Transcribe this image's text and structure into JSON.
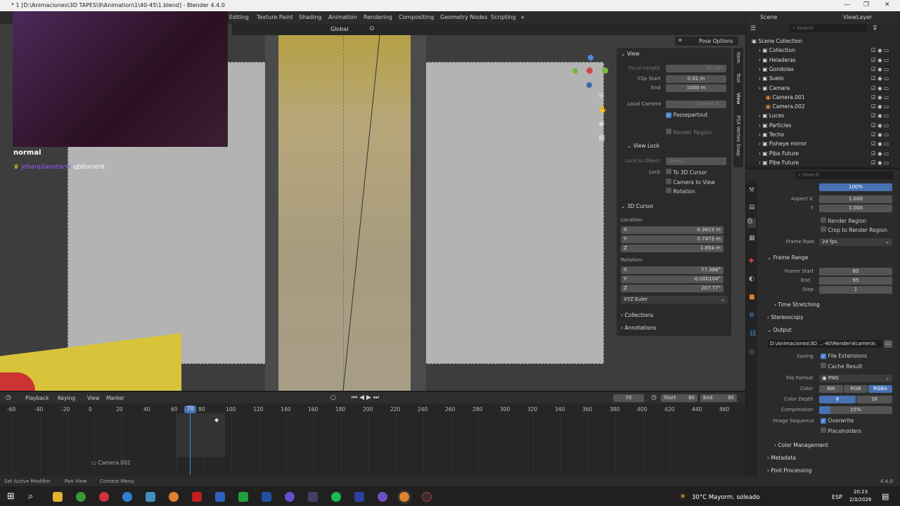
{
  "window": {
    "title": "* 1 [D:\\Animaciones\\3D TAPES\\9\\Animation\\1\\40-45\\1.blend] - Blender 4.4.0",
    "min": "—",
    "max": "❐",
    "close": "✕"
  },
  "workspaces": [
    "Editing",
    "Texture Paint",
    "Shading",
    "Animation",
    "Rendering",
    "Compositing",
    "Geometry Nodes",
    "Scripting",
    "+"
  ],
  "scene": {
    "label": "Scene",
    "viewlayer": "ViewLayer"
  },
  "viewport": {
    "orientation": "Global",
    "pose_options": "Pose Options"
  },
  "overlay": {
    "line1": "normal",
    "user": "johanplanetartx",
    "line2": "qbitorrent"
  },
  "npanel": {
    "tabs": [
      "Item",
      "Tool",
      "View",
      "PSX Vertex Snap"
    ],
    "view_header": "View",
    "focal_label": "Focal Length",
    "focal_value": "50 mm",
    "clip_start_label": "Clip Start",
    "clip_start": "0.01 m",
    "end_label": "End",
    "clip_end": "1000 m",
    "local_camera_label": "Local Camera",
    "local_camera_value": "Camera.0...",
    "passepartout": "Passepartout",
    "render_region": "Render Region",
    "view_lock_header": "View Lock",
    "lock_to_object": "Lock to Object",
    "object_ph": "Object",
    "lock_label": "Lock",
    "to_3d_cursor": "To 3D Cursor",
    "camera_to_view": "Camera to View",
    "rotation_lock": "Rotation",
    "cursor_header": "3D Cursor",
    "location_label": "Location:",
    "x": "X",
    "y": "Y",
    "z": "Z",
    "loc_x": "-0.3623 m",
    "loc_y": "0.7473 m",
    "loc_z": "1.854 m",
    "rotation_label": "Rotation:",
    "rot_x": "77.386°",
    "rot_y": "-0.000104°",
    "rot_z": "207.77°",
    "rot_mode": "XYZ Euler",
    "collections": "Collections",
    "annotations": "Annotations"
  },
  "outliner": {
    "search_ph": "Search",
    "items": [
      {
        "name": "Scene Collection",
        "indent": 0
      },
      {
        "name": "Collection",
        "indent": 1
      },
      {
        "name": "Heladeras",
        "indent": 1
      },
      {
        "name": "Gondolas",
        "indent": 1
      },
      {
        "name": "Suelo",
        "indent": 1
      },
      {
        "name": "Camara",
        "indent": 1
      },
      {
        "name": "Camera.001",
        "indent": 2
      },
      {
        "name": "Camera.002",
        "indent": 2
      },
      {
        "name": "Luces",
        "indent": 1
      },
      {
        "name": "Particles",
        "indent": 1
      },
      {
        "name": "Techo",
        "indent": 1
      },
      {
        "name": "Fisheye mirror",
        "indent": 1
      },
      {
        "name": "Piba Future",
        "indent": 1
      },
      {
        "name": "Pibe Future",
        "indent": 1
      }
    ]
  },
  "props": {
    "search_ph": "Search",
    "pct": "100%",
    "aspect_x_label": "Aspect X",
    "aspect_x": "1.000",
    "aspect_y_label": "Y",
    "aspect_y": "1.000",
    "render_region": "Render Region",
    "crop": "Crop to Render Region",
    "frame_rate_label": "Frame Rate",
    "frame_rate": "24 fps",
    "frame_range": "Frame Range",
    "frame_start_label": "Frame Start",
    "frame_start": "60",
    "end_label": "End",
    "frame_end": "95",
    "step_label": "Step",
    "step": "1",
    "time_stretching": "Time Stretching",
    "stereoscopy": "Stereoscopy",
    "output": "Output",
    "path": "D:\\Animaciones\\3D ...-40\\Render\\4camera\\",
    "saving_label": "Saving",
    "file_ext": "File Extensions",
    "cache_result": "Cache Result",
    "file_format_label": "File Format",
    "file_format": "PNG",
    "color_label": "Color",
    "bw": "BW",
    "rgb": "RGB",
    "rgba": "RGBA",
    "depth_label": "Color Depth",
    "d8": "8",
    "d16": "16",
    "compression_label": "Compression",
    "compression": "15%",
    "img_seq_label": "Image Sequence",
    "overwrite": "Overwrite",
    "placeholders": "Placeholders",
    "color_mgmt": "Color Management",
    "metadata": "Metadata",
    "post": "Post Processing"
  },
  "timeline": {
    "menus": [
      "Playback",
      "Keying",
      "View",
      "Marker"
    ],
    "current": "70",
    "start_label": "Start",
    "start": "60",
    "end_label": "End",
    "end": "95",
    "ticks": [
      "-60",
      "-40",
      "-20",
      "0",
      "20",
      "40",
      "60",
      "70",
      "80",
      "100",
      "120",
      "140",
      "160",
      "180",
      "200",
      "220",
      "240",
      "260",
      "280",
      "300",
      "320",
      "340",
      "360",
      "380",
      "400",
      "420",
      "440",
      "460"
    ],
    "camera_marker": "Camera.002"
  },
  "status": {
    "a": "Set Active Modifier",
    "b": "Pan View",
    "c": "Context Menu",
    "version": "4.4.0"
  },
  "taskbar": {
    "weather": "30°C  Mayorm. soleado",
    "lang": "ESP",
    "time": "20:23",
    "date": "2/3/2026"
  }
}
